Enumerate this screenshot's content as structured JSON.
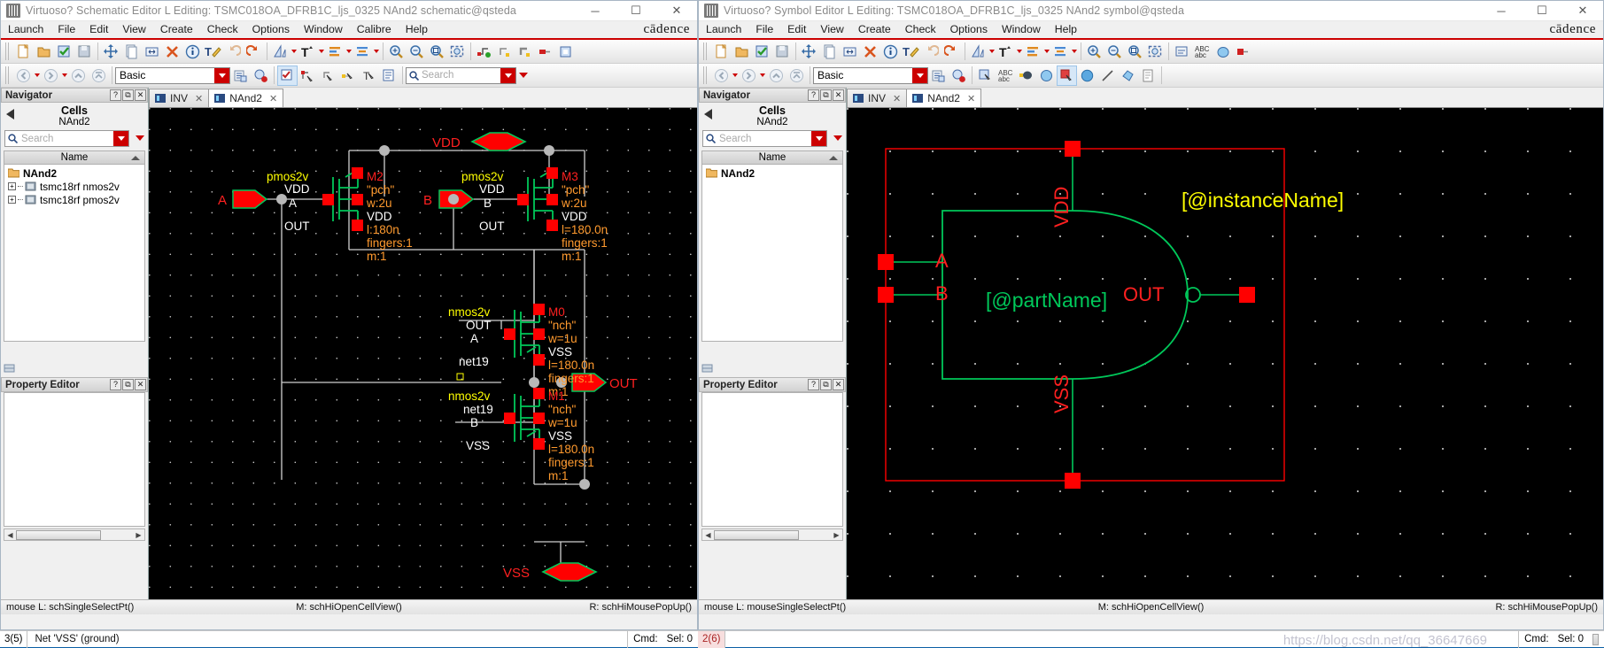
{
  "left_window": {
    "title": "Virtuoso? Schematic Editor L Editing: TSMC018OA_DFRB1C_ljs_0325 NAnd2 schematic@qsteda",
    "window_buttons": {
      "minimize": "─",
      "maximize": "☐",
      "close": "✕"
    },
    "brand": "cādence",
    "menus": [
      "Launch",
      "File",
      "Edit",
      "View",
      "Create",
      "Check",
      "Options",
      "Window",
      "Calibre",
      "Help"
    ],
    "library_combo": "Basic",
    "search_placeholder": "Search",
    "navigator": {
      "header": "Navigator",
      "header_buttons": [
        "?",
        "⧉",
        "✕"
      ],
      "cells_label": "Cells",
      "cell_name": "NAnd2",
      "search_placeholder": "Search",
      "column_header": "Name",
      "items": [
        {
          "label": "NAnd2",
          "type": "folder",
          "bold": true,
          "expandable": false
        },
        {
          "label": "tsmc18rf nmos2v",
          "type": "chip",
          "bold": false,
          "expandable": true
        },
        {
          "label": "tsmc18rf pmos2v",
          "type": "chip",
          "bold": false,
          "expandable": true
        }
      ]
    },
    "property_editor": {
      "header": "Property Editor",
      "header_buttons": [
        "?",
        "⧉",
        "✕"
      ]
    },
    "tabs": [
      {
        "label": "INV",
        "active": false,
        "close": "✕"
      },
      {
        "label": "NAnd2",
        "active": true,
        "close": "✕"
      }
    ],
    "mouse_bar": {
      "left": "mouse L: schSingleSelectPt()",
      "middle": "M: schHiOpenCellView()",
      "right": "R: schHiMousePopUp()"
    },
    "status": {
      "count": "3(5)",
      "message": "Net 'VSS' (ground)",
      "cmd": "Cmd:",
      "sel": "Sel: 0"
    }
  },
  "right_window": {
    "title": "Virtuoso? Symbol Editor L Editing: TSMC018OA_DFRB1C_ljs_0325 NAnd2 symbol@qsteda",
    "window_buttons": {
      "minimize": "─",
      "maximize": "☐",
      "close": "✕"
    },
    "brand": "cādence",
    "menus": [
      "Launch",
      "File",
      "Edit",
      "View",
      "Create",
      "Check",
      "Options",
      "Window",
      "Help"
    ],
    "library_combo": "Basic",
    "navigator": {
      "header": "Navigator",
      "header_buttons": [
        "?",
        "⧉",
        "✕"
      ],
      "cells_label": "Cells",
      "cell_name": "NAnd2",
      "search_placeholder": "Search",
      "column_header": "Name",
      "items": [
        {
          "label": "NAnd2",
          "type": "folder",
          "bold": true,
          "expandable": false
        }
      ]
    },
    "property_editor": {
      "header": "Property Editor",
      "header_buttons": [
        "?",
        "⧉",
        "✕"
      ]
    },
    "tabs": [
      {
        "label": "INV",
        "active": false,
        "close": "✕"
      },
      {
        "label": "NAnd2",
        "active": true,
        "close": "✕"
      }
    ],
    "mouse_bar": {
      "left": "mouse L: mouseSingleSelectPt()",
      "middle": "M: schHiOpenCellView()",
      "right": "R: schHiMousePopUp()"
    },
    "status": {
      "count": "2(6)",
      "message": "",
      "watermark": "https://blog.csdn.net/qq_36647669",
      "cmd": "Cmd:",
      "sel": "Sel: 0"
    }
  },
  "schematic": {
    "colors": {
      "background": "#000000",
      "wire": "#d0d0d0",
      "pin_red": "#ff0000",
      "device_green": "#00c85a",
      "label_yellow": "#ffff00",
      "param_orange": "#ff9a2e",
      "net_white": "#ffffff",
      "grid": "#cccccc"
    },
    "power_symbols": [
      {
        "label": "VDD",
        "shape": "hexagon"
      },
      {
        "label": "VSS",
        "shape": "hexagon"
      }
    ],
    "pins": [
      {
        "label": "A",
        "dir": "input"
      },
      {
        "label": "B",
        "dir": "input"
      },
      {
        "label": "OUT",
        "dir": "output"
      }
    ],
    "devices": [
      {
        "inst": "M2",
        "model": "pmos2v",
        "cell": "\"pch\"",
        "terms": [
          "VDD",
          "A",
          "OUT"
        ],
        "params": [
          "w:2u",
          "l:180n",
          "fingers:1",
          "m:1"
        ],
        "bulk": "VDD"
      },
      {
        "inst": "M3",
        "model": "pmos2v",
        "cell": "\"pch\"",
        "terms": [
          "VDD",
          "B",
          "OUT"
        ],
        "params": [
          "w:2u",
          "l=180.0n",
          "fingers:1",
          "m:1"
        ],
        "bulk": "VDD"
      },
      {
        "inst": "M0",
        "model": "nmos2v",
        "cell": "\"nch\"",
        "terms": [
          "OUT",
          "A",
          "net19"
        ],
        "params": [
          "w=1u",
          "l=180.0n",
          "fingers:1",
          "m:1"
        ],
        "bulk": "VSS"
      },
      {
        "inst": "M1",
        "model": "nmos2v",
        "cell": "\"nch\"",
        "terms": [
          "net19",
          "B",
          "VSS"
        ],
        "params": [
          "w=1u",
          "l=180.0n",
          "fingers:1",
          "m:1"
        ],
        "bulk": "VSS"
      }
    ],
    "nets": [
      "VDD",
      "VSS",
      "net19",
      "OUT",
      "A",
      "B"
    ]
  },
  "symbol": {
    "colors": {
      "background": "#000000",
      "outline_green": "#00c85a",
      "pin_red": "#ff0000",
      "label_red": "#ff2020",
      "text_green": "#00c85a",
      "text_yellow": "#ffff00"
    },
    "labels": {
      "vdd": "VDD",
      "vss": "VSS",
      "in_a": "A",
      "in_b": "B",
      "out": "OUT",
      "part_name": "[@partName]",
      "instance_name": "[@instanceName]"
    },
    "pins": [
      "VDD",
      "A",
      "B",
      "OUT",
      "VSS"
    ],
    "shape": "nand-gate-with-bubble"
  },
  "icons": {
    "new": "new-file-icon",
    "open": "open-folder-icon",
    "check": "check-save-icon",
    "save": "save-icon",
    "move": "move-icon",
    "copy": "copy-icon",
    "stretch": "stretch-icon",
    "delete": "delete-icon",
    "properties": "info-icon",
    "text": "text-edit-icon",
    "undo": "undo-icon",
    "redo": "redo-icon",
    "flip": "flip-icon",
    "zoom_in": "zoom-in-icon",
    "zoom_out": "zoom-out-icon",
    "zoom_fit": "zoom-fit-icon",
    "search": "search-icon"
  }
}
